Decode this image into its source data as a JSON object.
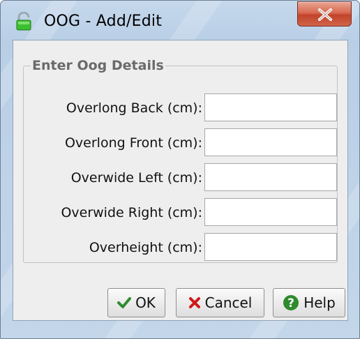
{
  "window": {
    "title": "OOG - Add/Edit",
    "close_icon": "close-icon"
  },
  "group": {
    "title": "Enter Oog Details"
  },
  "fields": [
    {
      "label": "Overlong Back (cm):",
      "value": ""
    },
    {
      "label": "Overlong Front (cm):",
      "value": ""
    },
    {
      "label": "Overwide Left (cm):",
      "value": ""
    },
    {
      "label": "Overwide Right (cm):",
      "value": ""
    },
    {
      "label": "Overheight (cm):",
      "value": ""
    }
  ],
  "buttons": {
    "ok": {
      "label": "OK",
      "icon": "check-icon",
      "icon_color": "#2e8b2e"
    },
    "cancel": {
      "label": "Cancel",
      "icon": "x-icon",
      "icon_color": "#d01818"
    },
    "help": {
      "label": "Help",
      "icon": "help-icon",
      "icon_color": "#2e8b2e"
    }
  },
  "colors": {
    "close_button": "#c8462c",
    "frame": "#c3d6ea",
    "client": "#eeeeee"
  }
}
